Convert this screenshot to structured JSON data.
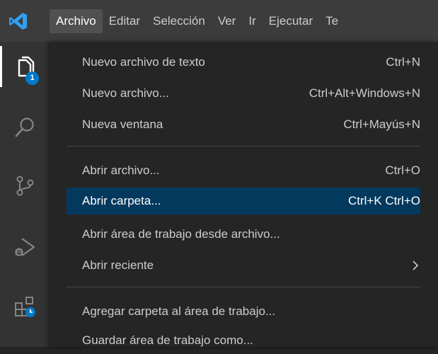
{
  "menubar": {
    "items": [
      "Archivo",
      "Editar",
      "Selección",
      "Ver",
      "Ir",
      "Ejecutar",
      "Te"
    ],
    "active_index": 0
  },
  "activitybar": {
    "icons": [
      "explorer-icon",
      "search-icon",
      "source-control-icon",
      "run-debug-icon",
      "extensions-icon"
    ],
    "explorer_badge": "1"
  },
  "file_menu": {
    "items": [
      {
        "label": "Nuevo archivo de texto",
        "shortcut": "Ctrl+N"
      },
      {
        "label": "Nuevo archivo...",
        "shortcut": "Ctrl+Alt+Windows+N"
      },
      {
        "label": "Nueva ventana",
        "shortcut": "Ctrl+Mayús+N"
      },
      {
        "label": "Abrir archivo...",
        "shortcut": "Ctrl+O"
      },
      {
        "label": "Abrir carpeta...",
        "shortcut": "Ctrl+K Ctrl+O"
      },
      {
        "label": "Abrir área de trabajo desde archivo...",
        "shortcut": ""
      },
      {
        "label": "Abrir reciente",
        "shortcut": ""
      },
      {
        "label": "Agregar carpeta al área de trabajo...",
        "shortcut": ""
      },
      {
        "label": "Guardar área de trabajo como...",
        "shortcut": ""
      }
    ],
    "selected_index": 4
  },
  "colors": {
    "accent": "#007acc",
    "selection": "#04395e",
    "menubar": "#3c3c3c",
    "menu_bg": "#252526"
  }
}
